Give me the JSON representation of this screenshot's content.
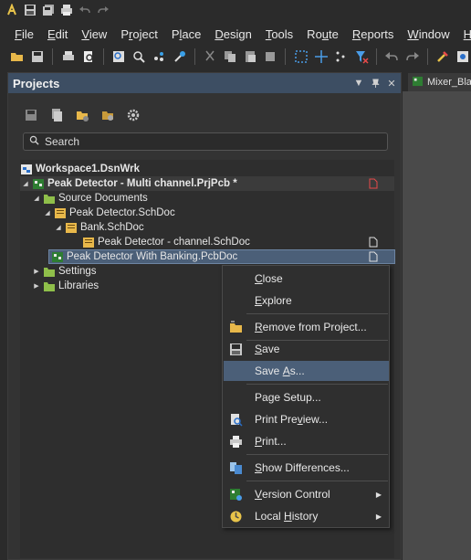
{
  "titlebar": {
    "icons": [
      "app-logo-icon",
      "save-icon",
      "save-all-icon",
      "print-icon",
      "undo-icon",
      "redo-icon"
    ]
  },
  "menubar": {
    "items": [
      {
        "label_first": "F",
        "label_rest": "ile"
      },
      {
        "label_first": "E",
        "label_rest": "dit"
      },
      {
        "label_first": "V",
        "label_rest": "iew"
      },
      {
        "label_first": "P",
        "label_rest": "roject",
        "underline_index": 1
      },
      {
        "label_first": "P",
        "label_rest": "lace",
        "underline_index": 1
      },
      {
        "label_first": "D",
        "label_rest": "esign"
      },
      {
        "label_first": "T",
        "label_rest": "ools"
      },
      {
        "label_first": "R",
        "label_rest": "oute",
        "underline_index": 2
      },
      {
        "label_first": "R",
        "label_rest": "eports"
      },
      {
        "label_first": "W",
        "label_rest": "indow"
      },
      {
        "label_first": "H",
        "label_rest": "elp"
      }
    ]
  },
  "panel": {
    "title": "Projects",
    "search_placeholder": "Search"
  },
  "tree": {
    "workspace": "Workspace1.DsnWrk",
    "project": "Peak Detector - Multi channel.PrjPcb *",
    "source_documents": "Source Documents",
    "sch1": "Peak Detector.SchDoc",
    "bank": "Bank.SchDoc",
    "channel": "Peak Detector - channel.SchDoc",
    "pcb": "Peak Detector With Banking.PcbDoc",
    "settings": "Settings",
    "libraries": "Libraries"
  },
  "doc_tab": {
    "label": "Mixer_Bla"
  },
  "context_menu": {
    "close": {
      "u": "C",
      "rest": "lose"
    },
    "explore": {
      "pre": "",
      "u": "E",
      "rest": "xplore"
    },
    "remove": {
      "pre": "",
      "u": "R",
      "rest": "emove from Project..."
    },
    "save": {
      "u": "S",
      "rest": "ave"
    },
    "save_as": {
      "pre": "Save ",
      "u": "A",
      "rest": "s..."
    },
    "page_setup": {
      "pre": "Pa",
      "u": "g",
      "rest": "e Setup..."
    },
    "print_preview": {
      "pre": "Print Pre",
      "u": "v",
      "rest": "iew..."
    },
    "print": {
      "u": "P",
      "rest": "rint..."
    },
    "show_diff": {
      "u": "S",
      "rest": "how Differences..."
    },
    "version_control": {
      "u": "V",
      "rest": "ersion Control"
    },
    "local_history": {
      "pre": "Local ",
      "u": "H",
      "rest": "istory"
    }
  },
  "colors": {
    "panel_header": "#3d4e63",
    "selection": "#4b5f78",
    "background": "#2b2b2b"
  }
}
